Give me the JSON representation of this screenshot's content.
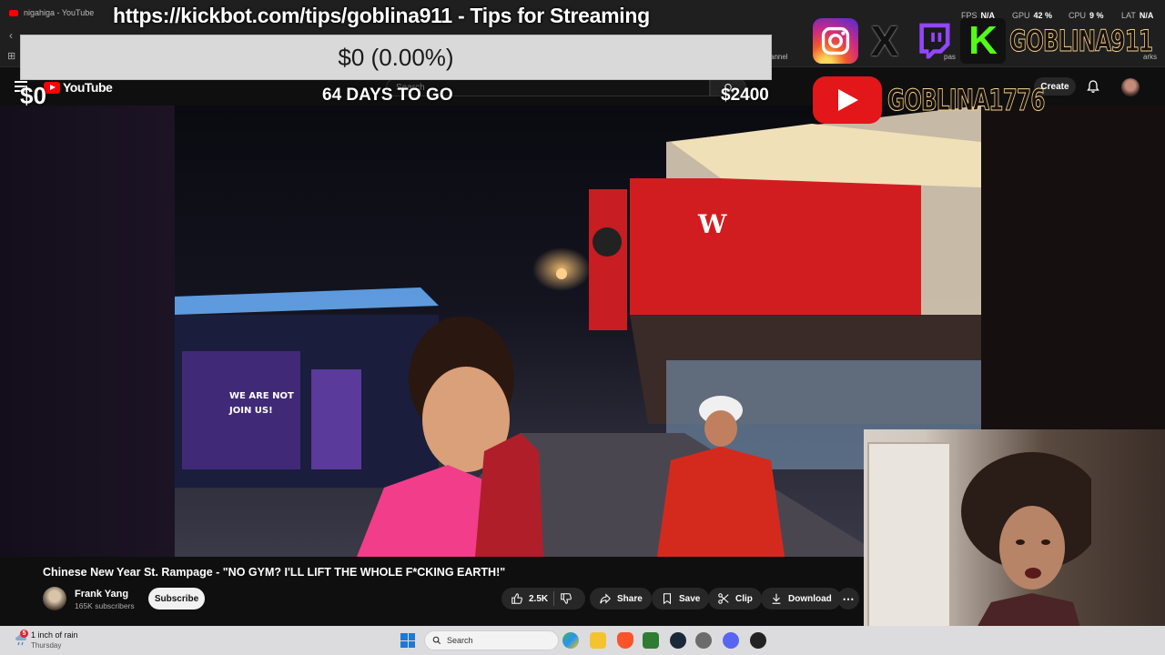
{
  "browser": {
    "active_tab_title": "nigahiga - YouTube",
    "bookmark_channel": "annel",
    "bookmark_other": "pas",
    "bookmark_end": "arks"
  },
  "stream_stats": [
    {
      "label": "FPS",
      "value": "N/A"
    },
    {
      "label": "GPU",
      "value": "42 %"
    },
    {
      "label": "CPU",
      "value": "9 %"
    },
    {
      "label": "LAT",
      "value": "N/A"
    }
  ],
  "youtube_header": {
    "logo_text": "YouTube",
    "search_placeholder": "Search",
    "create_label": "Create"
  },
  "overlay": {
    "tip_url_banner": "https://kickbot.com/tips/goblina911 - Tips for Streaming",
    "goal_progress_text": "$0 (0.00%)",
    "goal_progress_fraction": 0.0,
    "goal_current": "$0",
    "goal_days_left": "64 DAYS TO GO",
    "goal_target": "$2400",
    "social_handle_main": "GOBLINA911",
    "social_handle_youtube": "GOBLINA1776",
    "social_icons": [
      "instagram-icon",
      "x-icon",
      "twitch-icon",
      "kick-icon",
      "youtube-icon"
    ]
  },
  "video": {
    "title": "Chinese New Year St. Rampage - \"NO GYM? I'LL LIFT THE WHOLE F*CKING EARTH!\"",
    "channel_name": "Frank Yang",
    "subscriber_count": "165K subscribers",
    "subscribe_label": "Subscribe",
    "like_count": "2.5K",
    "share_label": "Share",
    "save_label": "Save",
    "clip_label": "Clip",
    "download_label": "Download",
    "sign_text_1": "WE ARE NOT",
    "sign_text_2": "JOIN US!"
  },
  "taskbar": {
    "weather_badge": "5",
    "weather_main": "1 inch of rain",
    "weather_day": "Thursday",
    "search_placeholder": "Search"
  },
  "colors": {
    "youtube_red": "#ff0000",
    "kick_green": "#53fc18",
    "twitch_purple": "#9146ff",
    "handle_fill": "#1a1008"
  }
}
